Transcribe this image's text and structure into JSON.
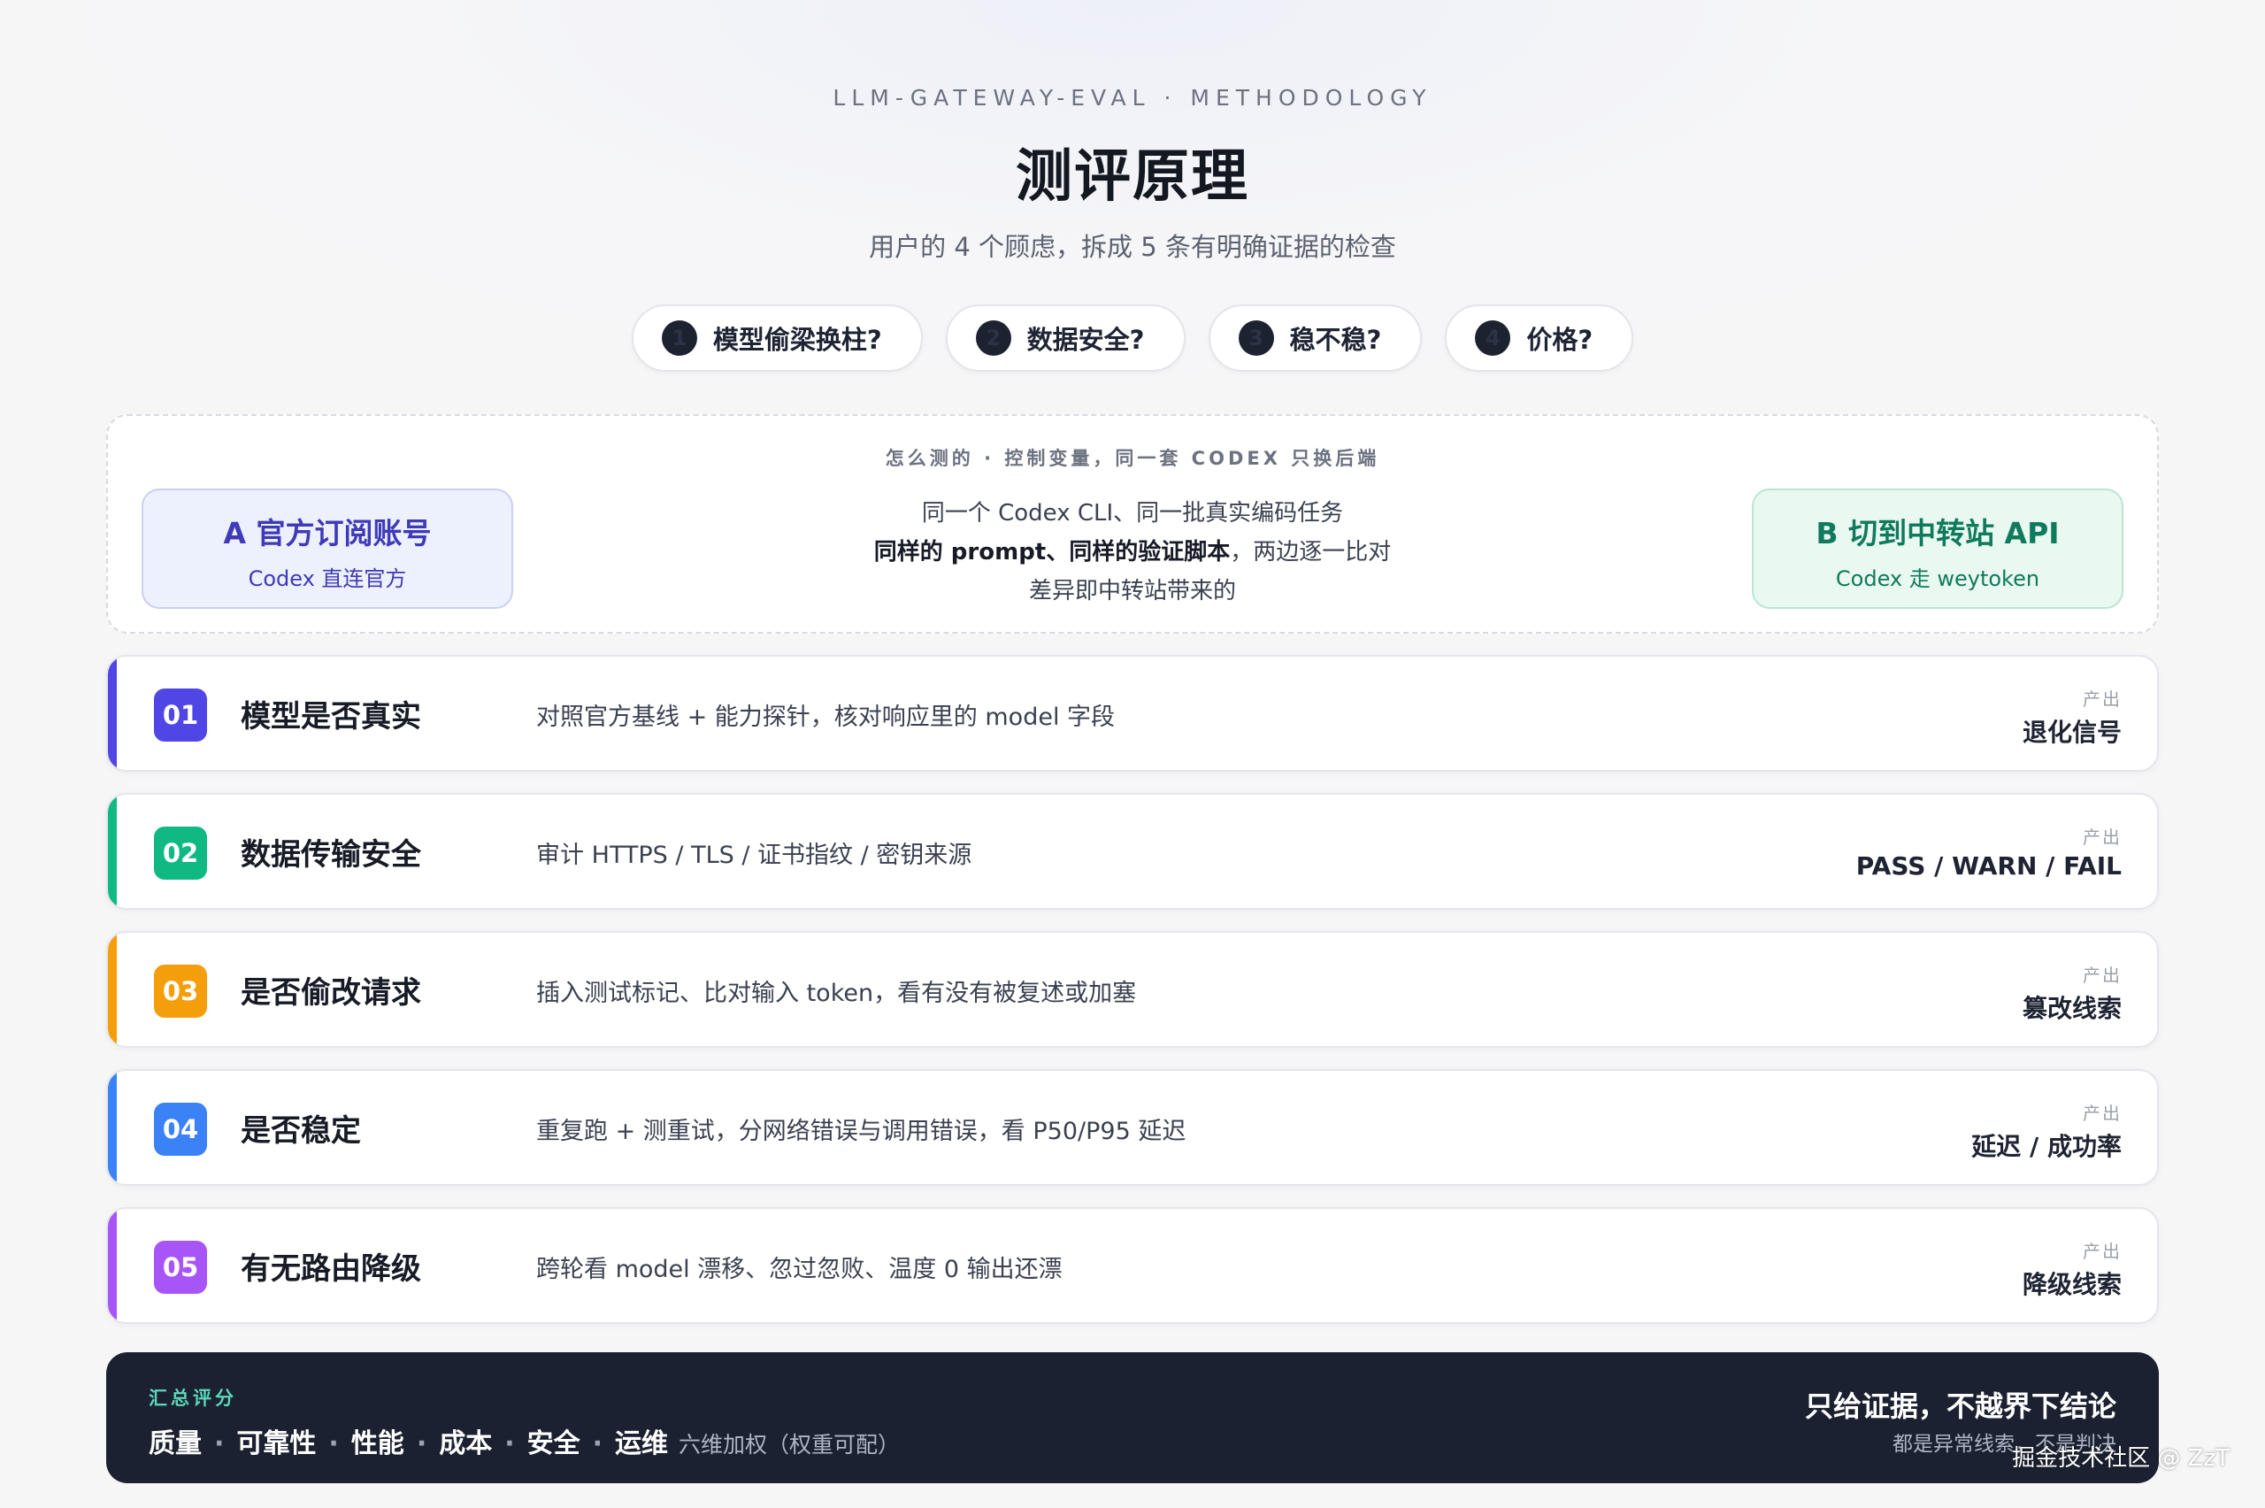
{
  "header": {
    "kicker": "LLM-GATEWAY-EVAL · METHODOLOGY",
    "title": "测评原理",
    "subtitle": "用户的 4 个顾虑，拆成 5 条有明确证据的检查"
  },
  "concerns": [
    {
      "num": "1",
      "label": "模型偷梁换柱?"
    },
    {
      "num": "2",
      "label": "数据安全?"
    },
    {
      "num": "3",
      "label": "稳不稳?"
    },
    {
      "num": "4",
      "label": "价格?"
    }
  ],
  "method": {
    "heading": "怎么测的 · 控制变量，同一套 CODEX 只换后端",
    "side_a": {
      "title": "A 官方订阅账号",
      "subtitle": "Codex 直连官方"
    },
    "side_b": {
      "title": "B 切到中转站 API",
      "subtitle": "Codex 走 weytoken"
    },
    "line1": "同一个 Codex CLI、同一批真实编码任务",
    "line2_bold": "同样的 prompt、同样的验证脚本",
    "line2_rest": "，两边逐一比对",
    "line3": "差异即中转站带来的"
  },
  "checks": [
    {
      "num": "01",
      "title": "模型是否真实",
      "desc": "对照官方基线 + 能力探针，核对响应里的 model 字段",
      "output_label": "产出",
      "output": "退化信号",
      "color": "#4f46e5"
    },
    {
      "num": "02",
      "title": "数据传输安全",
      "desc": "审计 HTTPS / TLS / 证书指纹 / 密钥来源",
      "output_label": "产出",
      "output": "PASS / WARN / FAIL",
      "color": "#10b981"
    },
    {
      "num": "03",
      "title": "是否偷改请求",
      "desc": "插入测试标记、比对输入 token，看有没有被复述或加塞",
      "output_label": "产出",
      "output": "篡改线索",
      "color": "#f59e0b"
    },
    {
      "num": "04",
      "title": "是否稳定",
      "desc": "重复跑 + 测重试，分网络错误与调用错误，看 P50/P95 延迟",
      "output_label": "产出",
      "output": "延迟 / 成功率",
      "color": "#3b82f6"
    },
    {
      "num": "05",
      "title": "有无路由降级",
      "desc": "跨轮看 model 漂移、忽过忽败、温度 0 输出还漂",
      "output_label": "产出",
      "output": "降级线索",
      "color": "#a855f7"
    }
  ],
  "summary": {
    "label": "汇总评分",
    "dims": [
      "质量",
      "可靠性",
      "性能",
      "成本",
      "安全",
      "运维"
    ],
    "separator": "·",
    "note": "六维加权（权重可配）",
    "right_title": "只给证据，不越界下结论",
    "right_sub": "都是异常线索，不是判决"
  },
  "watermark": "掘金技术社区 @ ZzT"
}
